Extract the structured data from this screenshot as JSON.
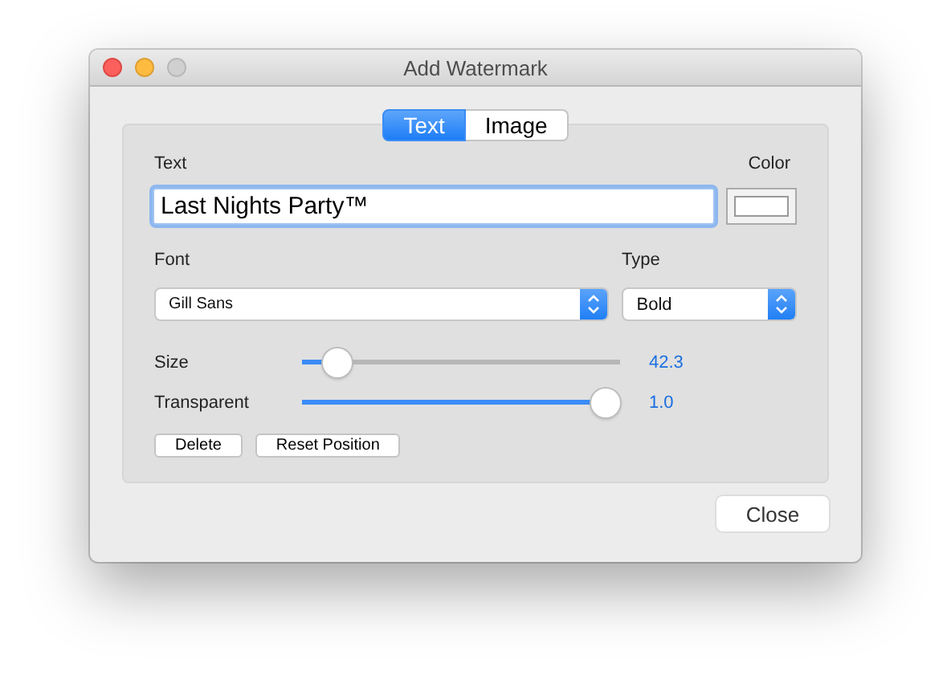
{
  "window": {
    "title": "Add Watermark"
  },
  "tabs": [
    {
      "label": "Text",
      "selected": true
    },
    {
      "label": "Image",
      "selected": false
    }
  ],
  "text_field": {
    "label": "Text",
    "value": "Last Nights Party™"
  },
  "color_picker": {
    "label": "Color",
    "color": "#ffffff"
  },
  "font_select": {
    "label": "Font",
    "value": "Gill Sans"
  },
  "type_select": {
    "label": "Type",
    "value": "Bold"
  },
  "sliders": [
    {
      "label": "Size",
      "level": 0.07,
      "reading": "42.3"
    },
    {
      "label": "Transparent",
      "level": 1.0,
      "reading": "1.0"
    }
  ],
  "panel_buttons": [
    "Delete",
    "Reset Position"
  ],
  "footer_button": "Close"
}
